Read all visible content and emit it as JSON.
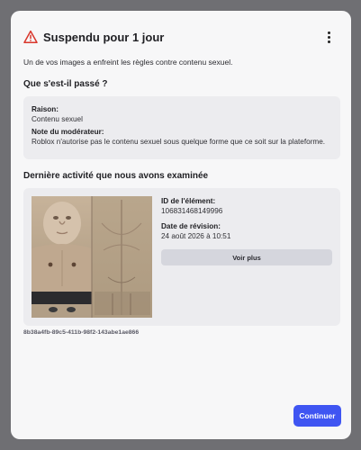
{
  "header": {
    "title": "Suspendu pour 1 jour",
    "warning_color": "#d9362b"
  },
  "intro": "Un de vos images a enfreint les règles contre contenu sexuel.",
  "what_happened": {
    "heading": "Que s'est-il passé ?",
    "reason_label": "Raison:",
    "reason_value": "Contenu sexuel",
    "note_label": "Note du modérateur:",
    "note_value": "Roblox n'autorise pas le contenu sexuel sous quelque forme que ce soit sur la plateforme."
  },
  "activity": {
    "heading": "Dernière activité que nous avons examinée",
    "item_id_label": "ID de l'élément:",
    "item_id_value": "106831468149996",
    "review_date_label": "Date de révision:",
    "review_date_value": "24 août 2026 à 10:51",
    "see_more_label": "Voir plus",
    "uuid": "8b38a4fb-89c5-411b-98f2-143abe1ae866"
  },
  "footer": {
    "continue_label": "Continuer",
    "accent_color": "#3f55f2"
  }
}
